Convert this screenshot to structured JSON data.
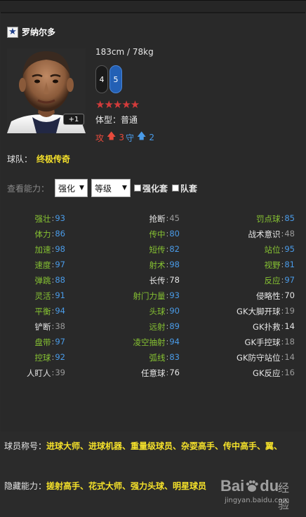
{
  "player": {
    "name": "罗纳尔多",
    "height_weight": "183cm / 78kg",
    "weak_foot": "4",
    "strong_foot": "5",
    "stars": "★★★★★",
    "body_type": "体型：普通",
    "work_rate": {
      "attack_label": "攻",
      "attack_value": "3",
      "defense_label": "守",
      "defense_value": "2"
    },
    "level_tag": "+1"
  },
  "team": {
    "label": "球队：",
    "value": "终极传奇"
  },
  "controls": {
    "label": "查看能力：",
    "select_strength": "强化",
    "select_level": "等级",
    "check_strength_set": "强化套",
    "check_team_set": "队套"
  },
  "stats": [
    [
      {
        "k": "强壮",
        "v": "93",
        "kc": "green",
        "vc": "blue"
      },
      {
        "k": "抢断",
        "v": "45",
        "kc": "white",
        "vc": "gray"
      },
      {
        "k": "罚点球",
        "v": "85",
        "kc": "green",
        "vc": "blue"
      }
    ],
    [
      {
        "k": "体力",
        "v": "86",
        "kc": "green",
        "vc": "blue"
      },
      {
        "k": "传中",
        "v": "80",
        "kc": "green",
        "vc": "blue"
      },
      {
        "k": "战术意识",
        "v": "48",
        "kc": "white",
        "vc": "gray"
      }
    ],
    [
      {
        "k": "加速",
        "v": "98",
        "kc": "green",
        "vc": "blue"
      },
      {
        "k": "短传",
        "v": "82",
        "kc": "green",
        "vc": "blue"
      },
      {
        "k": "站位",
        "v": "95",
        "kc": "green",
        "vc": "blue"
      }
    ],
    [
      {
        "k": "速度",
        "v": "97",
        "kc": "green",
        "vc": "blue"
      },
      {
        "k": "射术",
        "v": "98",
        "kc": "green",
        "vc": "blue"
      },
      {
        "k": "视野",
        "v": "81",
        "kc": "green",
        "vc": "blue"
      }
    ],
    [
      {
        "k": "弹跳",
        "v": "88",
        "kc": "green",
        "vc": "blue"
      },
      {
        "k": "长传",
        "v": "78",
        "kc": "white",
        "vc": "white"
      },
      {
        "k": "反应",
        "v": "97",
        "kc": "green",
        "vc": "blue"
      }
    ],
    [
      {
        "k": "灵活",
        "v": "91",
        "kc": "green",
        "vc": "blue"
      },
      {
        "k": "射门力量",
        "v": "93",
        "kc": "green",
        "vc": "blue"
      },
      {
        "k": "侵略性",
        "v": "70",
        "kc": "white",
        "vc": "white"
      }
    ],
    [
      {
        "k": "平衡",
        "v": "94",
        "kc": "green",
        "vc": "blue"
      },
      {
        "k": "头球",
        "v": "90",
        "kc": "green",
        "vc": "blue"
      },
      {
        "k": "GK大脚开球",
        "v": "19",
        "kc": "white",
        "vc": "gray"
      }
    ],
    [
      {
        "k": "铲断",
        "v": "38",
        "kc": "white",
        "vc": "gray"
      },
      {
        "k": "远射",
        "v": "89",
        "kc": "green",
        "vc": "blue"
      },
      {
        "k": "GK扑救",
        "v": "14",
        "kc": "white",
        "vc": "white"
      }
    ],
    [
      {
        "k": "盘带",
        "v": "97",
        "kc": "green",
        "vc": "blue"
      },
      {
        "k": "凌空抽射",
        "v": "94",
        "kc": "green",
        "vc": "blue"
      },
      {
        "k": "GK手控球",
        "v": "18",
        "kc": "white",
        "vc": "gray"
      }
    ],
    [
      {
        "k": "控球",
        "v": "92",
        "kc": "green",
        "vc": "blue"
      },
      {
        "k": "弧线",
        "v": "83",
        "kc": "green",
        "vc": "blue"
      },
      {
        "k": "GK防守站位",
        "v": "14",
        "kc": "white",
        "vc": "gray"
      }
    ],
    [
      {
        "k": "人盯人",
        "v": "39",
        "kc": "white",
        "vc": "gray"
      },
      {
        "k": "任意球",
        "v": "76",
        "kc": "white",
        "vc": "white"
      },
      {
        "k": "GK反应",
        "v": "16",
        "kc": "white",
        "vc": "gray"
      }
    ]
  ],
  "titles": {
    "label": "球员称号：",
    "value": "进球大师、进球机器、重量级球员、杂耍高手、传中高手、翼、"
  },
  "hidden_abilities": {
    "label": "隐藏能力：",
    "value": "搓射高手、花式大师、强力头球、明星球员"
  },
  "watermark": {
    "logo_left": "Bai",
    "logo_right": "du",
    "suffix": "经验",
    "url": "jingyan.baidu.com"
  },
  "colors": {
    "background": "#292929",
    "name_yellow": "#f5e12a",
    "stat_green": "#86c232",
    "stat_blue": "#4a9be8",
    "stars_red": "#d33b3b",
    "attack_red": "#e84b3c"
  },
  "icons": {
    "badge": "star-badge-icon",
    "attack_arrow": "arrow-up-icon",
    "defense_arrow": "arrow-up-icon"
  }
}
